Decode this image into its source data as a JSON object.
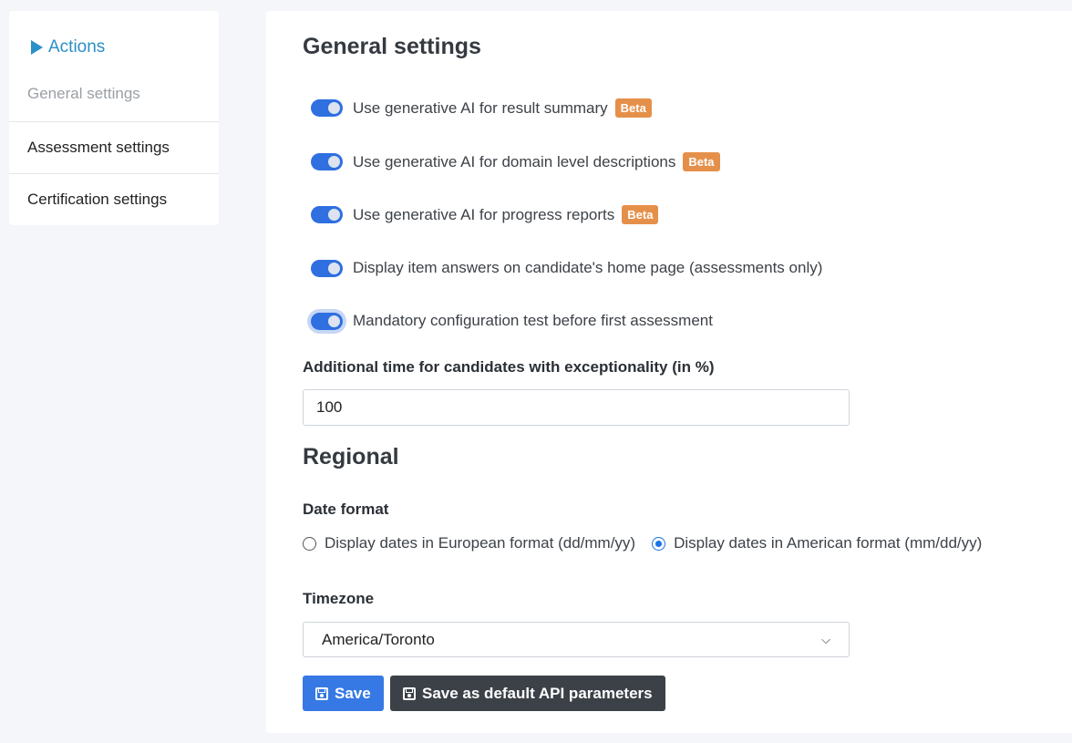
{
  "sidebar": {
    "title": "Actions",
    "items": [
      {
        "label": "General settings",
        "active": true
      },
      {
        "label": "Assessment settings",
        "active": false
      },
      {
        "label": "Certification settings",
        "active": false
      }
    ]
  },
  "general": {
    "title": "General settings",
    "toggles": [
      {
        "label": "Use generative AI for result summary",
        "badge": "Beta",
        "checked": true
      },
      {
        "label": "Use generative AI for domain level descriptions",
        "badge": "Beta",
        "checked": true
      },
      {
        "label": "Use generative AI for progress reports",
        "badge": "Beta",
        "checked": true
      },
      {
        "label": "Display item answers on candidate's home page (assessments only)",
        "checked": true
      },
      {
        "label": "Mandatory configuration test before first assessment",
        "checked": true
      }
    ],
    "additional_time_label": "Additional time for candidates with exceptionality (in %)",
    "additional_time_value": "100"
  },
  "regional": {
    "title": "Regional",
    "date_format_label": "Date format",
    "date_options": [
      {
        "label": "Display dates in European format (dd/mm/yy)",
        "checked": false
      },
      {
        "label": "Display dates in American format (mm/dd/yy)",
        "checked": true
      }
    ],
    "timezone_label": "Timezone",
    "timezone_value": "America/Toronto"
  },
  "buttons": {
    "save": "Save",
    "save_default": "Save as default API parameters"
  },
  "colors": {
    "accent": "#2c8fc9",
    "toggle_on": "#2f6fe0",
    "badge": "#e5904a",
    "primary_button": "#3679e4",
    "dark_button": "#3c4148"
  }
}
